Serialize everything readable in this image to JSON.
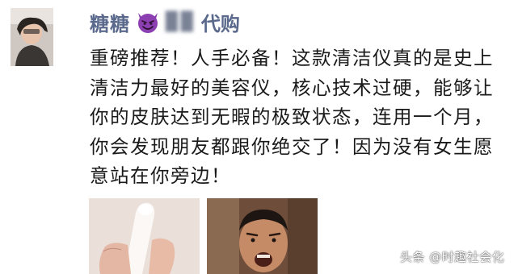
{
  "post": {
    "username": "糖糖",
    "username_icon": "smiling-devil-emoji",
    "blurred_name": "▉▉",
    "tag": "代购",
    "body": "重磅推荐！人手必备！这款清洁仪真的是史上清洁力最好的美容仪，核心技术过硬，能够让你的皮肤达到无暇的极致状态，连用一个月，你会发现朋友都跟你绝交了！因为没有女生愿意站在你旁边！"
  },
  "watermark": "头条 @时趣社会化",
  "colors": {
    "username": "#5b6a8c",
    "devil_purple": "#8b3fb0",
    "text": "#1a1a1a"
  }
}
